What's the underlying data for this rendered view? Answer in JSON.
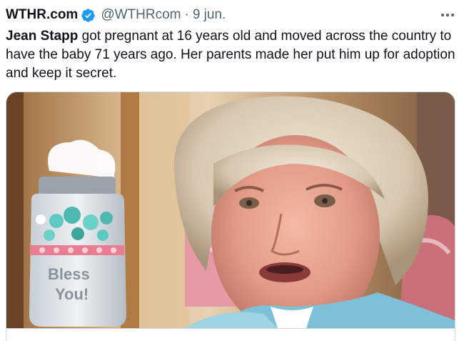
{
  "tweet": {
    "author_name": "WTHR.com",
    "handle": "@WTHRcom",
    "separator": "·",
    "date": "9 jun.",
    "text_bold": "Jean Stapp",
    "text_rest": " got pregnant at 16 years old and moved across the country to have the baby 71 years ago. Her parents made her put him up for adoption and keep it secret.",
    "verified_icon": "verified-badge-icon",
    "more_icon": "more-options-icon"
  },
  "media": {
    "jar_text_line1": "Bless",
    "jar_text_line2": "You!"
  },
  "colors": {
    "text": "#0f1419",
    "secondary": "#536471",
    "verified": "#1d9bf0",
    "border": "#cfd9de"
  }
}
